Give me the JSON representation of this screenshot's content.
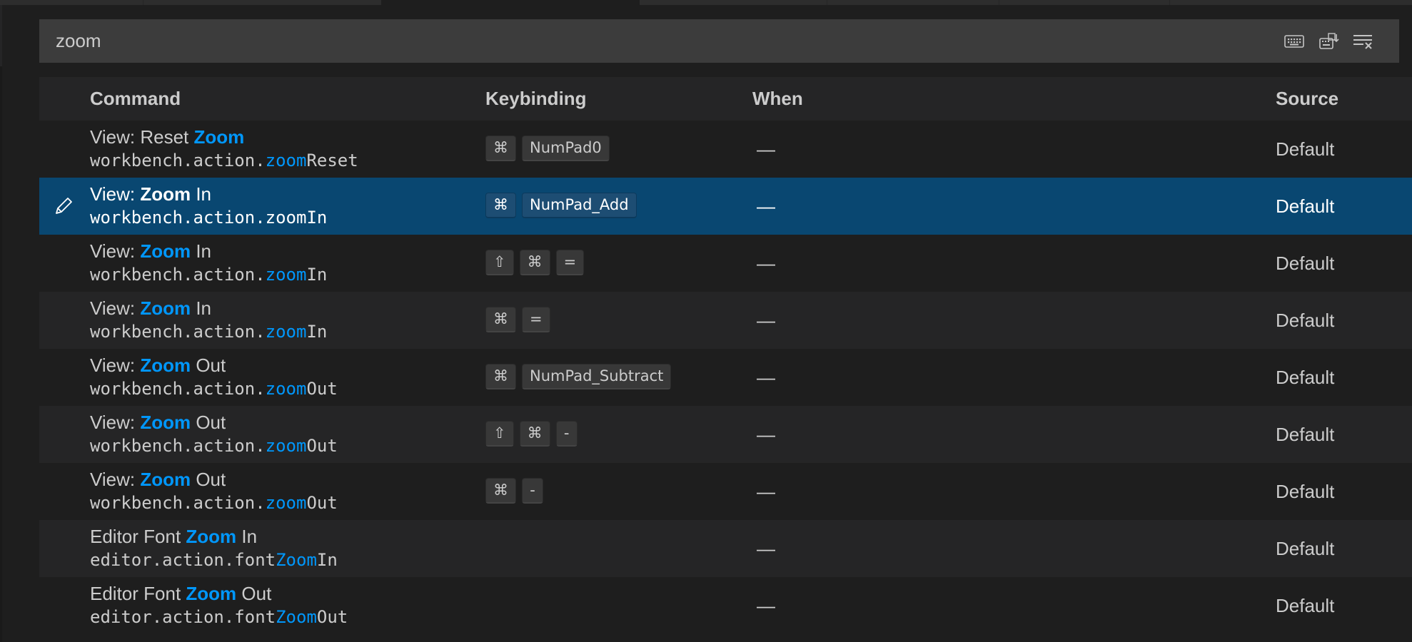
{
  "search": {
    "value": "zoom",
    "placeholder": ""
  },
  "toolbar": {
    "icons": [
      "keyboard-icon",
      "record-keys-icon",
      "clear-search-icon"
    ]
  },
  "columns": {
    "command": "Command",
    "keybinding": "Keybinding",
    "when": "When",
    "source": "Source"
  },
  "rows": [
    {
      "title_pre": "View: Reset ",
      "title_hl": "Zoom",
      "title_post": "",
      "id_pre": "workbench.action.",
      "id_hl": "zoom",
      "id_post": "Reset",
      "keys": [
        "⌘",
        "NumPad0"
      ],
      "when": "—",
      "source": "Default",
      "selected": false
    },
    {
      "title_pre": "View: ",
      "title_hl": "Zoom",
      "title_post": " In",
      "id_pre": "workbench.action.",
      "id_hl": "zoom",
      "id_post": "In",
      "keys": [
        "⌘",
        "NumPad_Add"
      ],
      "when": "—",
      "source": "Default",
      "selected": true
    },
    {
      "title_pre": "View: ",
      "title_hl": "Zoom",
      "title_post": " In",
      "id_pre": "workbench.action.",
      "id_hl": "zoom",
      "id_post": "In",
      "keys": [
        "⇧",
        "⌘",
        "="
      ],
      "when": "—",
      "source": "Default",
      "selected": false
    },
    {
      "title_pre": "View: ",
      "title_hl": "Zoom",
      "title_post": " In",
      "id_pre": "workbench.action.",
      "id_hl": "zoom",
      "id_post": "In",
      "keys": [
        "⌘",
        "="
      ],
      "when": "—",
      "source": "Default",
      "selected": false
    },
    {
      "title_pre": "View: ",
      "title_hl": "Zoom",
      "title_post": " Out",
      "id_pre": "workbench.action.",
      "id_hl": "zoom",
      "id_post": "Out",
      "keys": [
        "⌘",
        "NumPad_Subtract"
      ],
      "when": "—",
      "source": "Default",
      "selected": false
    },
    {
      "title_pre": "View: ",
      "title_hl": "Zoom",
      "title_post": " Out",
      "id_pre": "workbench.action.",
      "id_hl": "zoom",
      "id_post": "Out",
      "keys": [
        "⇧",
        "⌘",
        "-"
      ],
      "when": "—",
      "source": "Default",
      "selected": false
    },
    {
      "title_pre": "View: ",
      "title_hl": "Zoom",
      "title_post": " Out",
      "id_pre": "workbench.action.",
      "id_hl": "zoom",
      "id_post": "Out",
      "keys": [
        "⌘",
        "-"
      ],
      "when": "—",
      "source": "Default",
      "selected": false
    },
    {
      "title_pre": "Editor Font ",
      "title_hl": "Zoom",
      "title_post": " In",
      "id_pre": "editor.action.font",
      "id_hl": "Zoom",
      "id_post": "In",
      "keys": [],
      "when": "—",
      "source": "Default",
      "selected": false
    },
    {
      "title_pre": "Editor Font ",
      "title_hl": "Zoom",
      "title_post": " Out",
      "id_pre": "editor.action.font",
      "id_hl": "Zoom",
      "id_post": "Out",
      "keys": [],
      "when": "—",
      "source": "Default",
      "selected": false
    }
  ],
  "colors": {
    "background": "#1e1e1e",
    "alt_row": "#252526",
    "selected_row": "#094771",
    "highlight": "#0097fb",
    "search_bg": "#3c3c3c"
  }
}
